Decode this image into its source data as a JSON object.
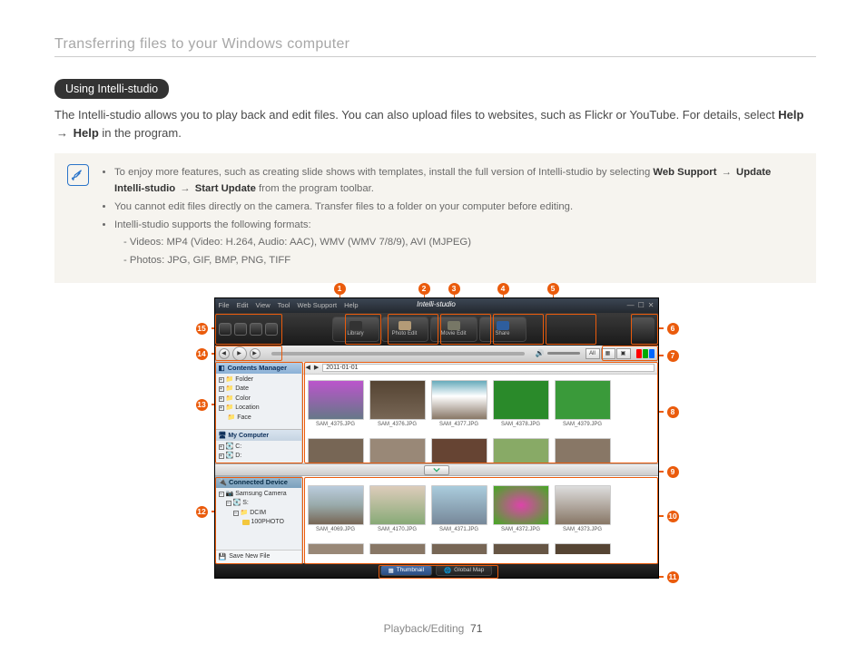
{
  "header": "Transferring files to your Windows computer",
  "pill": "Using Intelli-studio",
  "intro": {
    "text1": "The Intelli-studio allows you to play back and edit files. You can also upload files to websites, such as Flickr or YouTube. For details, select ",
    "help1": "Help",
    "arrow": "→",
    "help2": "Help",
    "text2": " in the program."
  },
  "note": {
    "b1_pre": "To enjoy more features, such as creating slide shows with templates, install the full version of Intelli-studio by selecting ",
    "b1_ws": "Web Support",
    "b1_upd": "Update Intelli-studio",
    "b1_start": "Start Update",
    "b1_post": " from the program toolbar.",
    "b2": "You cannot edit files directly on the camera. Transfer files to a folder on your computer before editing.",
    "b3": "Intelli-studio supports the following formats:",
    "s1": "Videos: MP4 (Video: H.264, Audio: AAC), WMV (WMV 7/8/9), AVI (MJPEG)",
    "s2": "Photos: JPG, GIF, BMP, PNG, TIFF"
  },
  "app": {
    "brand": "Intelli-studio",
    "menus": [
      "File",
      "Edit",
      "View",
      "Tool",
      "Web Support",
      "Help"
    ],
    "tabs": {
      "library": "Library",
      "photo": "Photo Edit",
      "movie": "Movie Edit",
      "share": "Share"
    },
    "viewAll": "All",
    "contentsManager": "Contents Manager",
    "tree": [
      "Folder",
      "Date",
      "Color",
      "Location",
      "Face"
    ],
    "myComputer": "My Computer",
    "drives": [
      "C:",
      "D:"
    ],
    "breadcrumb": "2011-01-01",
    "thumbsTop": [
      "SAM_4375.JPG",
      "SAM_4376.JPG",
      "SAM_4377.JPG",
      "SAM_4378.JPG",
      "SAM_4379.JPG"
    ],
    "connectedDevice": "Connected Device",
    "device": "Samsung Camera",
    "devTree": [
      "S:",
      "DCIM",
      "100PHOTO"
    ],
    "thumbsBot": [
      "SAM_4069.JPG",
      "SAM_4170.JPG",
      "SAM_4371.JPG",
      "SAM_4372.JPG",
      "SAM_4373.JPG"
    ],
    "saveNew": "Save New File",
    "footer": {
      "thumb": "Thumbnail",
      "map": "Global Map"
    }
  },
  "callouts": [
    "1",
    "2",
    "3",
    "4",
    "5",
    "6",
    "7",
    "8",
    "9",
    "10",
    "11",
    "12",
    "13",
    "14",
    "15"
  ],
  "footer": {
    "section": "Playback/Editing",
    "page": "71"
  }
}
